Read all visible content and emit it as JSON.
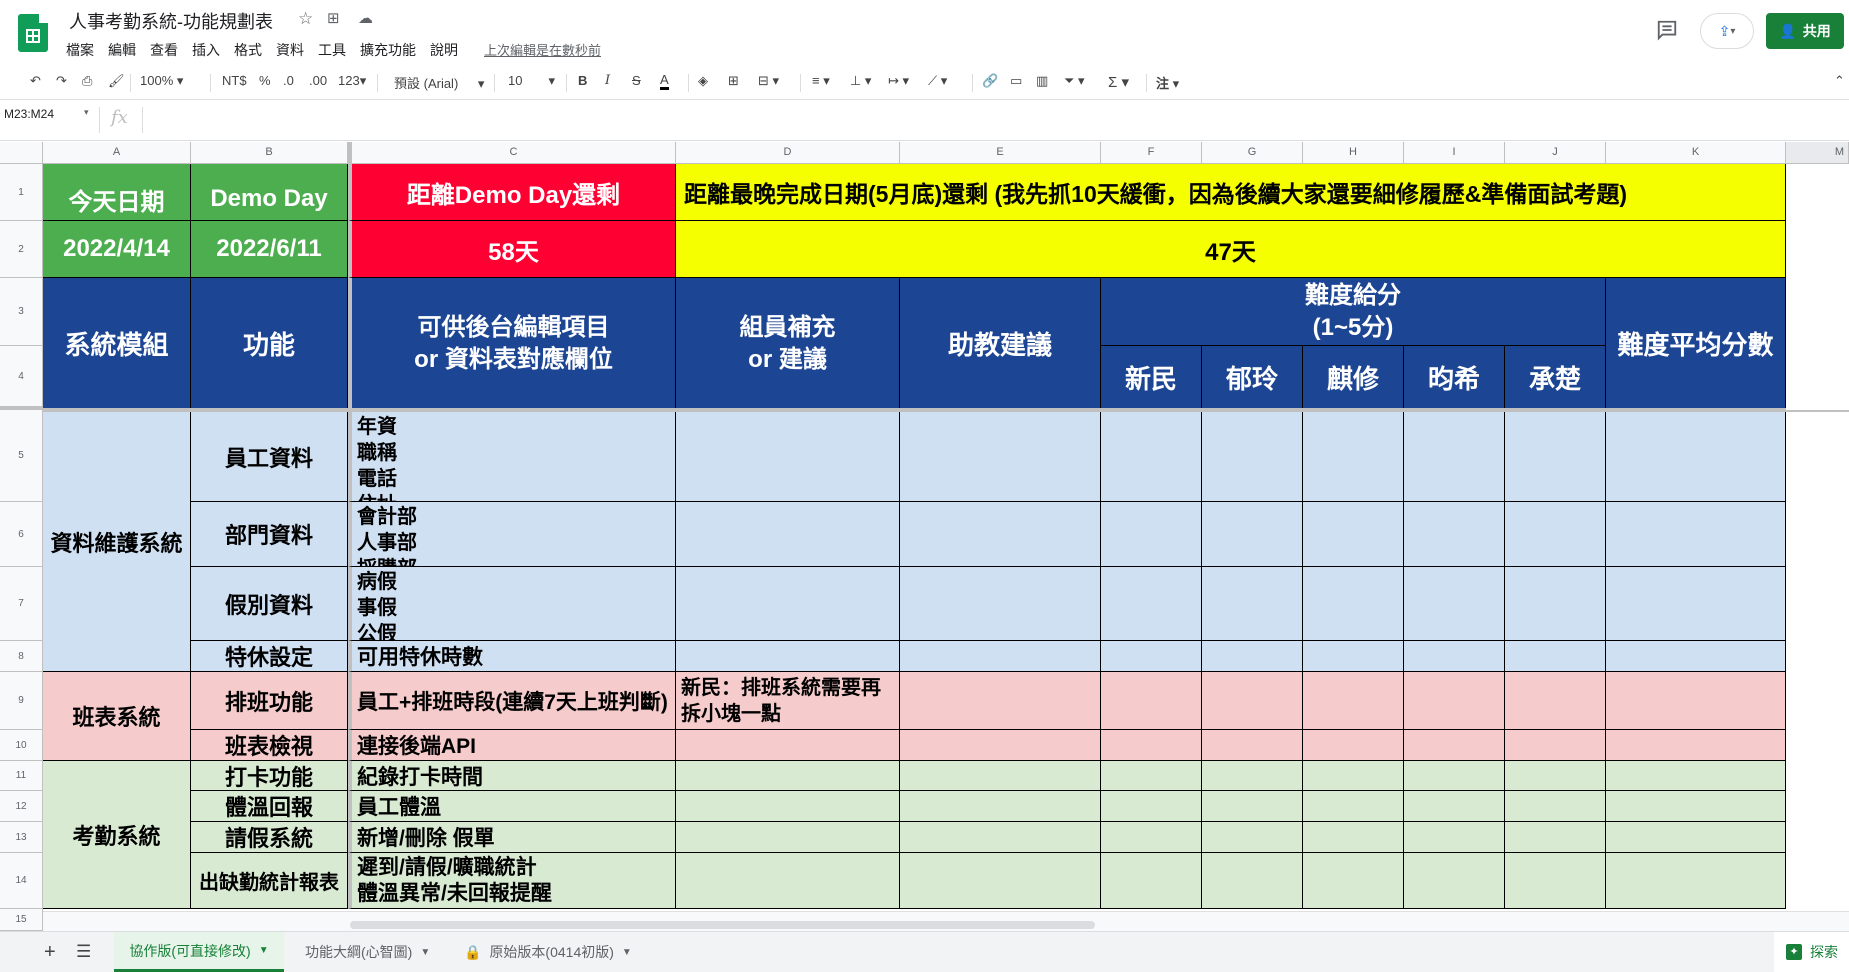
{
  "app": {
    "doc_title": "人事考勤系統-功能規劃表",
    "menu": [
      "檔案",
      "編輯",
      "查看",
      "插入",
      "格式",
      "資料",
      "工具",
      "擴充功能",
      "說明"
    ],
    "last_edit": "上次編輯是在數秒前",
    "share_label": "共用"
  },
  "toolbar": {
    "zoom": "100%",
    "currency": "NT$",
    "percent": "%",
    "dec_less": ".0",
    "dec_more": ".00",
    "number_format": "123",
    "font": "預設 (Arial)",
    "font_size": "10",
    "bold": "B",
    "italic": "I",
    "strike": "S",
    "textcolor": "A",
    "sigma": "Σ",
    "input_tools": "注"
  },
  "formula_bar": {
    "name_box": "M23:M24",
    "fx": "fx"
  },
  "columns": [
    "A",
    "B",
    "C",
    "D",
    "E",
    "F",
    "G",
    "H",
    "I",
    "J",
    "K",
    "M"
  ],
  "rows": [
    "1",
    "2",
    "3",
    "4",
    "5",
    "6",
    "7",
    "8",
    "9",
    "10",
    "11",
    "12",
    "13",
    "14",
    "15"
  ],
  "sheet": {
    "today_label": "今天日期",
    "today_value": "2022/4/14",
    "demo_label": "Demo Day",
    "demo_value": "2022/6/11",
    "countdown_label": "距離Demo Day還剩",
    "countdown_value": "58天",
    "deadline_label": "距離最晚完成日期(5月底)還剩 (我先抓10天緩衝，因為後續大家還要細修履歷&準備面試考題)",
    "deadline_value": "47天",
    "headers": {
      "module": "系統模組",
      "feature": "功能",
      "fields": "可供後台編輯項目\nor 資料表對應欄位",
      "member": "組員補充\nor 建議",
      "ta": "助教建議",
      "difficulty": "難度給分\n(1~5分)",
      "avg": "難度平均分數",
      "people": [
        "新民",
        "郁玲",
        "麒修",
        "昀希",
        "承楚"
      ]
    },
    "modules": {
      "data": "資料維護系統",
      "shift": "班表系統",
      "attendance": "考勤系統"
    },
    "features": {
      "r5": "員工資料",
      "r6": "部門資料",
      "r7": "假別資料",
      "r8": "特休設定",
      "r9": "排班功能",
      "r10": "班表檢視",
      "r11": "打卡功能",
      "r12": "體溫回報",
      "r13": "請假系統",
      "r14": "出缺勤統計報表"
    },
    "fields": {
      "r5": "年資\n職稱\n電話\n住址",
      "r6": "會計部\n人事部\n採購部",
      "r7": "病假\n事假\n公假",
      "r8": "可用特休時數",
      "r9": "員工+排班時段(連續7天上班判斷)",
      "r10": "連接後端API",
      "r11": "紀錄打卡時間",
      "r12": "員工體溫",
      "r13": "新增/刪除 假單",
      "r14": "遲到/請假/曠職統計\n體溫異常/未回報提醒"
    },
    "member_notes": {
      "r9": "新民：排班系統需要再拆小塊一點"
    }
  },
  "tabs": [
    {
      "label": "協作版(可直接修改)",
      "active": true
    },
    {
      "label": "功能大綱(心智圖)",
      "active": false
    },
    {
      "label": "原始版本(0414初版)",
      "active": false
    }
  ],
  "explore_label": "探索",
  "colors": {
    "green": "#4cae4f",
    "red": "#ff0033",
    "yellow": "#f5ff00",
    "navy": "#1c4593",
    "lightblue": "#cfe0f3",
    "pink": "#f6cbcc",
    "lightgreen": "#d9ead3"
  }
}
